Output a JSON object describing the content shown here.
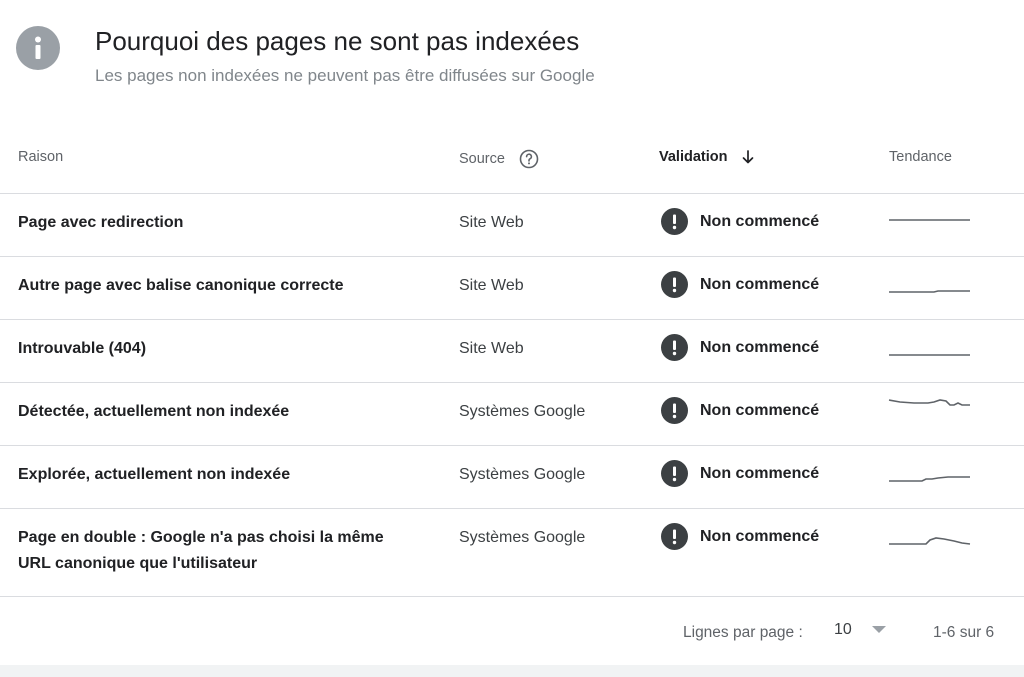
{
  "header": {
    "title": "Pourquoi des pages ne sont pas indexées",
    "subtitle": "Les pages non indexées ne peuvent pas être diffusées sur Google",
    "icon": "info-icon"
  },
  "table": {
    "columns": {
      "reason": "Raison",
      "source": "Source",
      "validation": "Validation",
      "trend": "Tendance"
    },
    "rows": [
      {
        "reason": "Page avec redirection",
        "source": "Site Web",
        "status": "Non commencé"
      },
      {
        "reason": "Autre page avec balise canonique correcte",
        "source": "Site Web",
        "status": "Non commencé"
      },
      {
        "reason": "Introuvable (404)",
        "source": "Site Web",
        "status": "Non commencé"
      },
      {
        "reason": "Détectée, actuellement non indexée",
        "source": "Systèmes Google",
        "status": "Non commencé"
      },
      {
        "reason": "Explorée, actuellement non indexée",
        "source": "Systèmes Google",
        "status": "Non commencé"
      },
      {
        "reason": "Page en double : Google n'a pas choisi la même URL canonique que l'utilisateur",
        "source": "Systèmes Google",
        "status": "Non commencé"
      }
    ]
  },
  "pagination": {
    "rows_label": "Lignes par page :",
    "rows_value": "10",
    "range": "1-6 sur 6"
  },
  "colors": {
    "status_icon": "#3c4043",
    "info_icon": "#9aa0a6",
    "sparkline": "#5f6368"
  }
}
